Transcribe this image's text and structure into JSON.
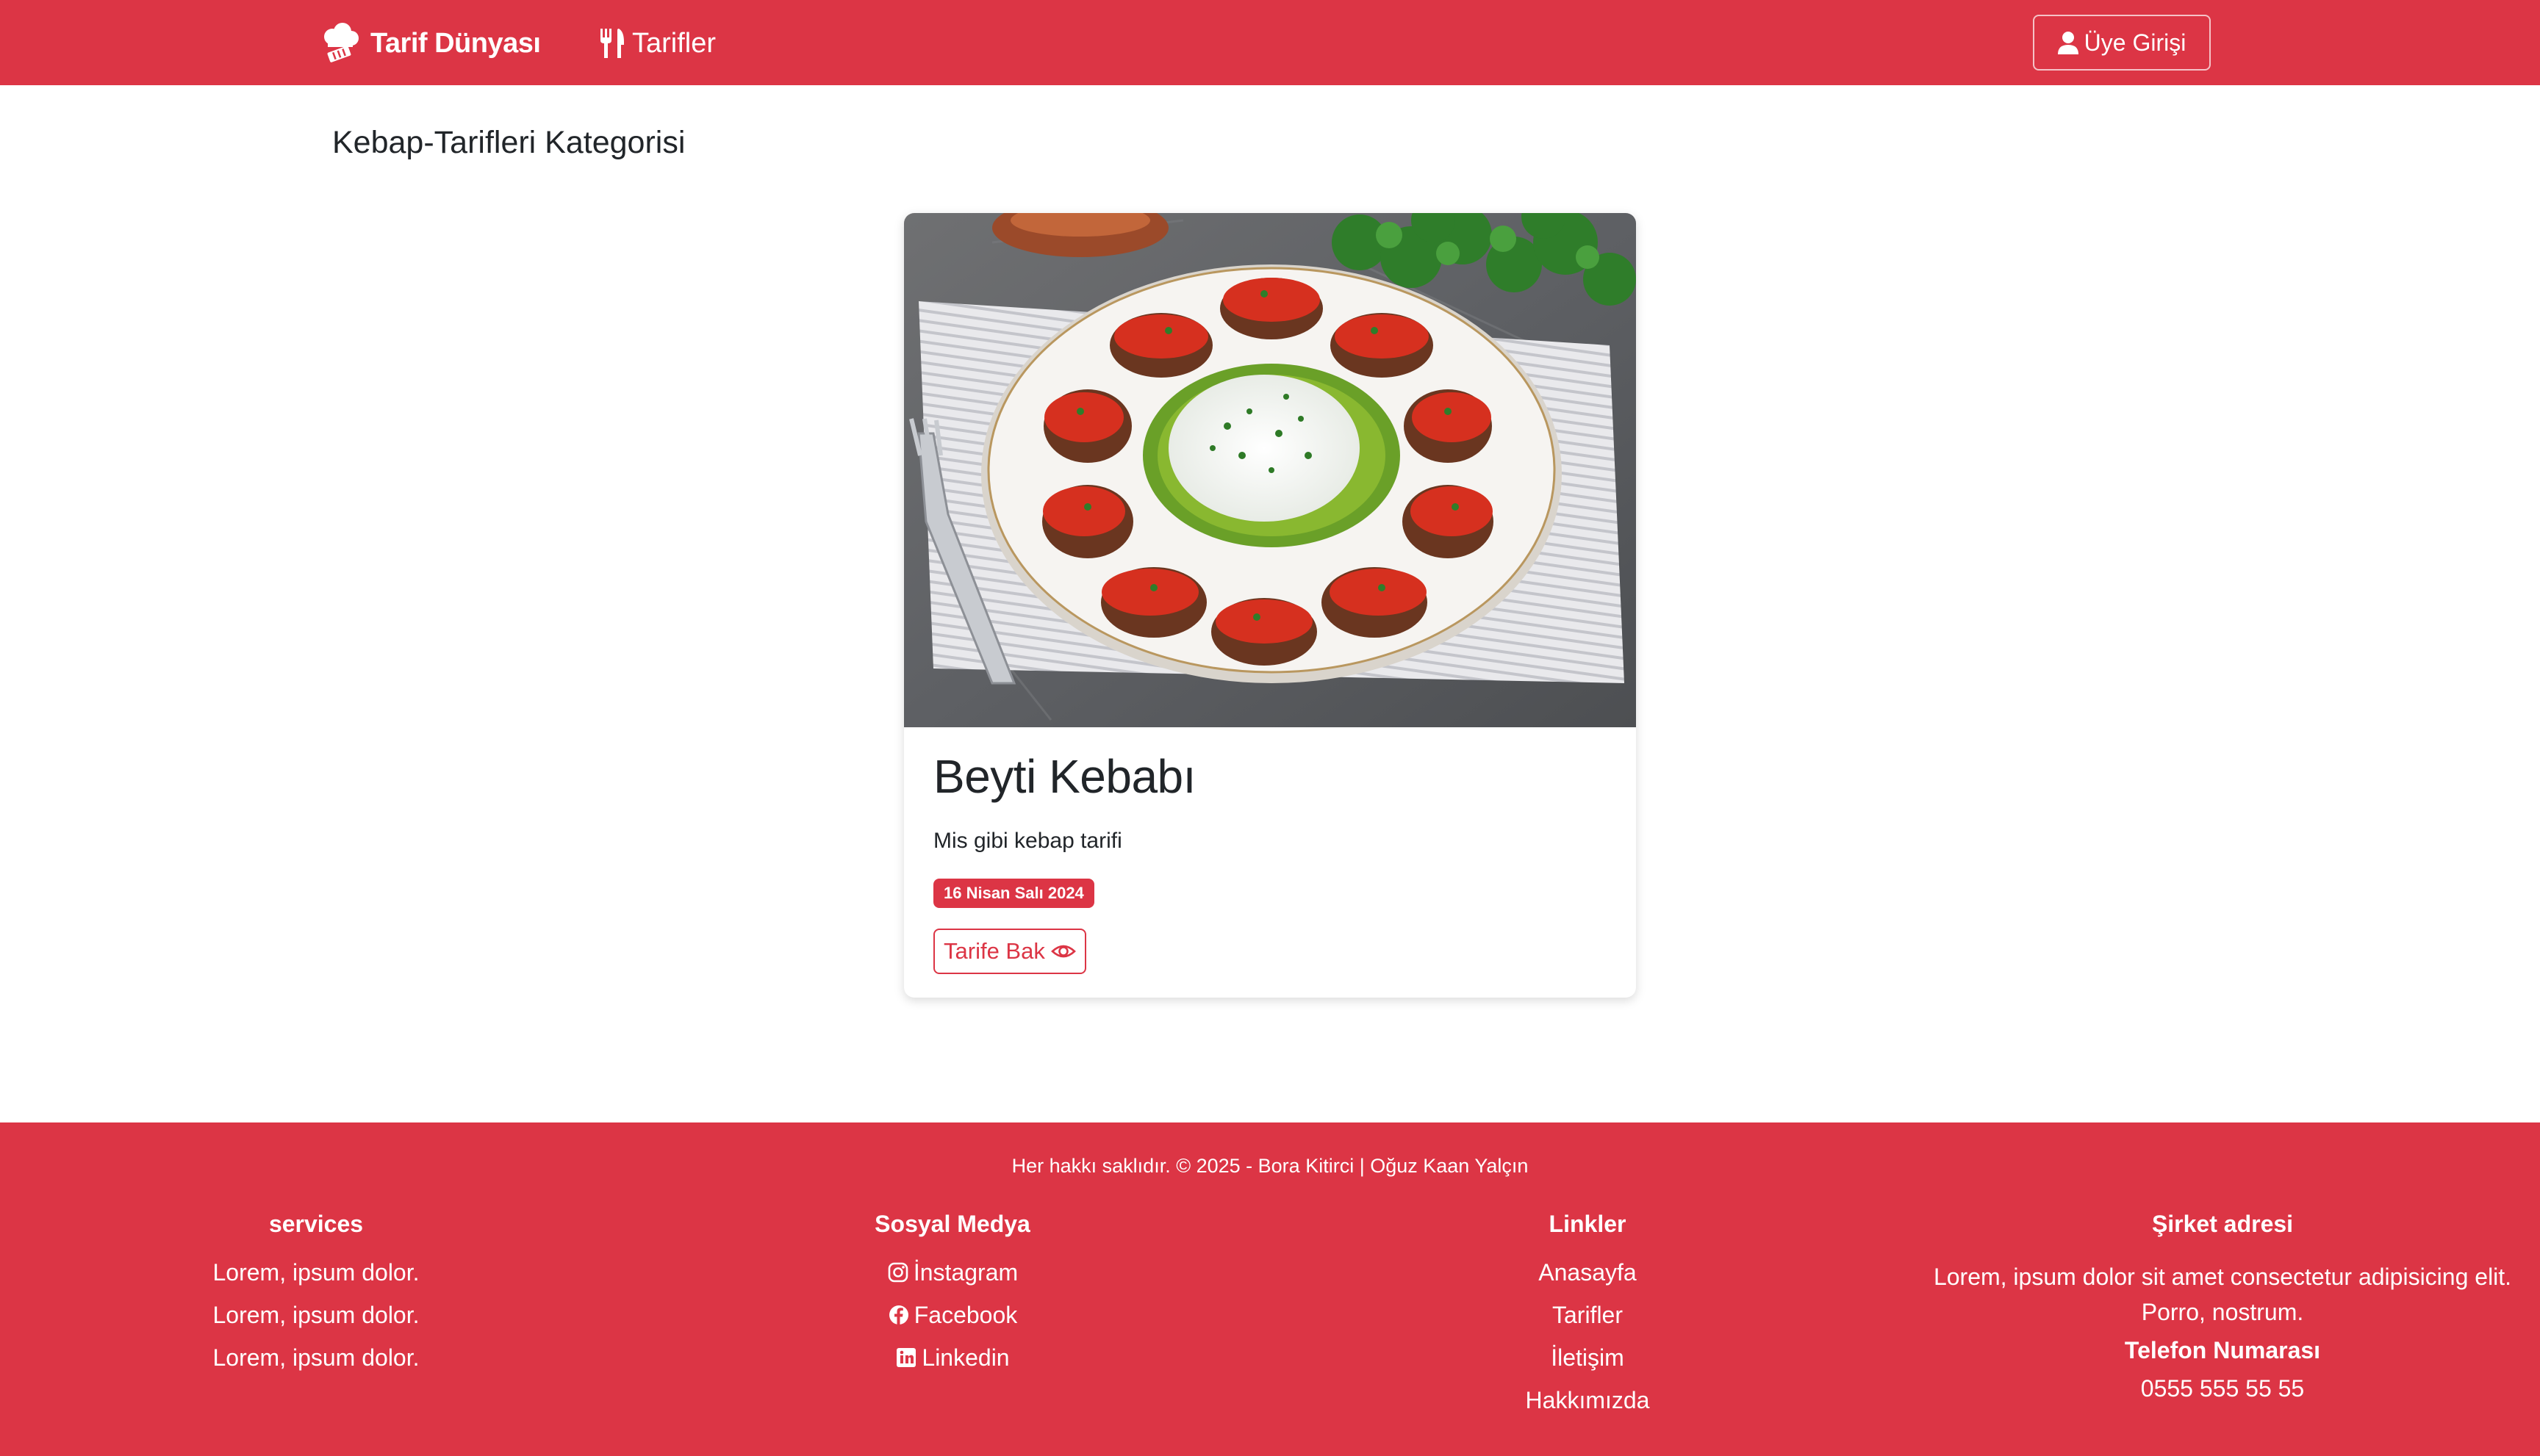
{
  "navbar": {
    "brand": "Tarif Dünyası",
    "recipes_link": "Tarifler",
    "login_button": "Üye Girişi",
    "brand_color": "#dc3545"
  },
  "page": {
    "heading": "Kebap-Tarifleri Kategorisi"
  },
  "recipe_card": {
    "title": "Beyti Kebabı",
    "description": "Mis gibi kebap tarifi",
    "date_badge": "16 Nisan Salı 2024",
    "view_button": "Tarife Bak",
    "image_icon": "beyti-kebab-photo"
  },
  "footer": {
    "copyright": "Her hakkı saklıdır. © 2025 - Bora Kitirci | Oğuz Kaan Yalçın",
    "services": {
      "heading": "services",
      "items": [
        "Lorem, ipsum dolor.",
        "Lorem, ipsum dolor.",
        "Lorem, ipsum dolor."
      ]
    },
    "social": {
      "heading": "Sosyal Medya",
      "items": [
        "İnstagram",
        "Facebook",
        "Linkedin"
      ]
    },
    "links": {
      "heading": "Linkler",
      "items": [
        "Anasayfa",
        "Tarifler",
        "İletişim",
        "Hakkımızda"
      ]
    },
    "company": {
      "heading": "Şirket adresi",
      "address": "Lorem, ipsum dolor sit amet consectetur adipisicing elit. Porro, nostrum.",
      "phone_heading": "Telefon Numarası",
      "phone": "0555 555 55 55"
    }
  }
}
